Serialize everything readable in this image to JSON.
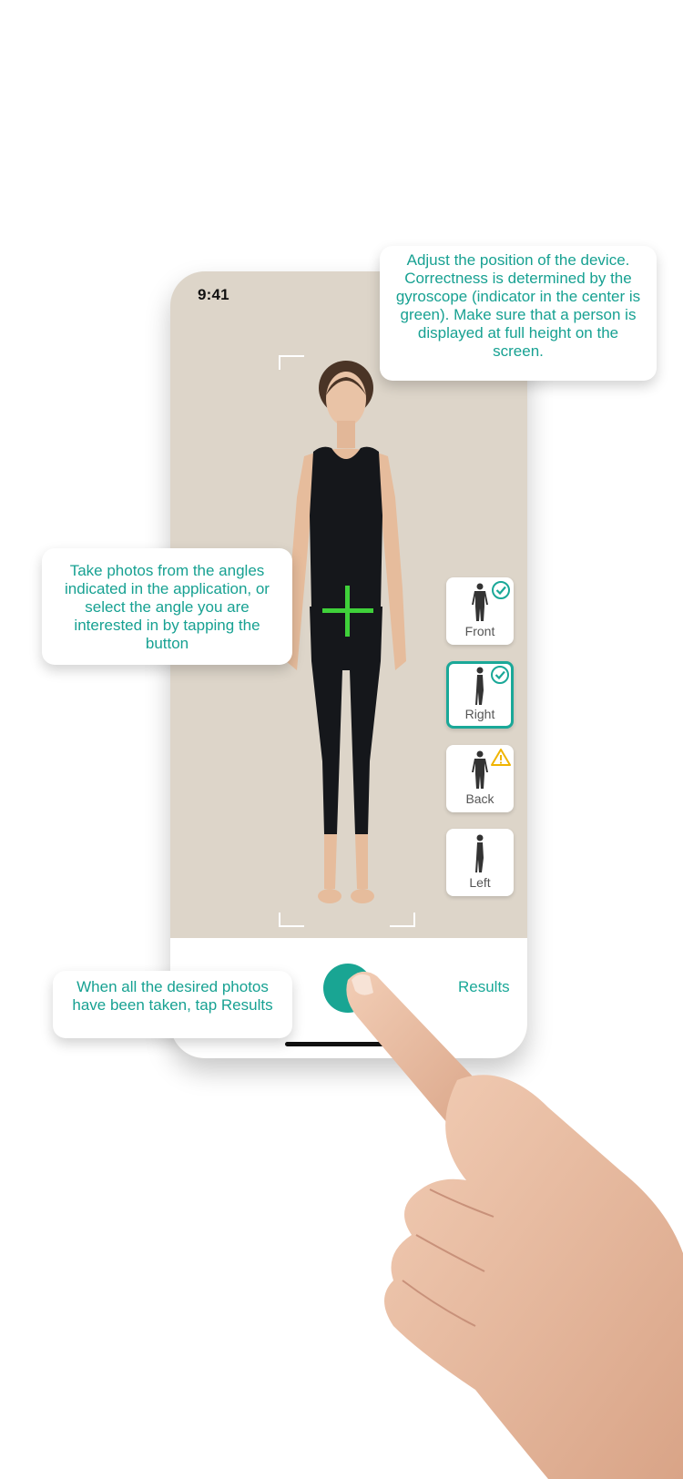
{
  "status_bar": {
    "time": "9:41"
  },
  "angles": [
    {
      "label": "Front",
      "state": "done"
    },
    {
      "label": "Right",
      "state": "done",
      "selected": true
    },
    {
      "label": "Back",
      "state": "warning"
    },
    {
      "label": "Left",
      "state": "none"
    }
  ],
  "bottom": {
    "results_label": "Results"
  },
  "callouts": {
    "adjust": "Adjust the position of the device. Correctness is determined by the gyroscope (indicator in the center is green). Make sure that a person is displayed at full height on the screen.",
    "angles": "Take photos from the angles indicated in the application, or select the angle you are interested in by tapping the button",
    "results": "When all the desired photos have been taken, tap Results"
  },
  "colors": {
    "accent": "#1aa898",
    "crosshair": "#3fd13a",
    "warning": "#f0b400",
    "camera_background": "#ddd5c9"
  }
}
